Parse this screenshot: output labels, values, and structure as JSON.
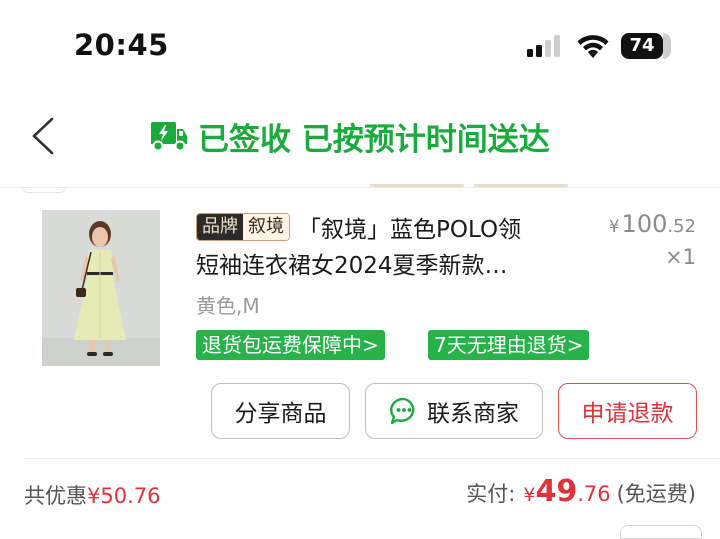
{
  "status_bar": {
    "time": "20:45",
    "battery": "74"
  },
  "header": {
    "status_text": "已签收 已按预计时间送达"
  },
  "product": {
    "brand_key": "品牌",
    "brand_value": "叙境",
    "title_line1": "「叙境」蓝色POLO领",
    "title_line2": "短袖连衣裙女2024夏季新款…",
    "price_currency": "¥",
    "price_int": "100",
    "price_dec": ".52",
    "quantity": "×1",
    "spec": "黄色,M",
    "tags": [
      "退货包运费保障中>",
      "7天无理由退货>"
    ]
  },
  "actions": {
    "share": "分享商品",
    "contact": "联系商家",
    "refund": "申请退款"
  },
  "totals": {
    "discount_label": "共优惠",
    "discount_amount": "¥50.76",
    "paid_label": "实付:",
    "paid_currency": "¥",
    "paid_int": "49",
    "paid_dec": ".76",
    "paid_note": "(免运费)"
  },
  "colors": {
    "accent_green": "#1aab3d",
    "tag_green": "#27b24a",
    "price_red": "#e0323a"
  }
}
